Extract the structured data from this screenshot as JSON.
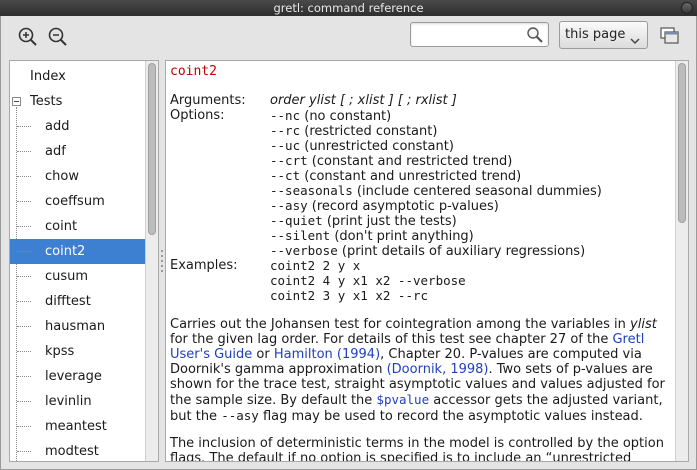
{
  "window": {
    "title": "gretl: command reference"
  },
  "toolbar": {
    "zoom_in_icon": "zoom-in-icon",
    "zoom_out_icon": "zoom-out-icon",
    "search_value": "",
    "scope_selected": "this page"
  },
  "tree": {
    "index_label": "Index",
    "tests_label": "Tests",
    "items": [
      "add",
      "adf",
      "chow",
      "coeffsum",
      "coint",
      "coint2",
      "cusum",
      "difftest",
      "hausman",
      "kpss",
      "leverage",
      "levinlin",
      "meantest",
      "modtest"
    ],
    "selected": "coint2"
  },
  "doc": {
    "command": "coint2",
    "arguments_label": "Arguments:",
    "arguments_value": "order ylist [ ; xlist ] [ ; rxlist ]",
    "options_label": "Options:",
    "options": [
      {
        "flag": "--nc",
        "desc": " (no constant)"
      },
      {
        "flag": "--rc",
        "desc": " (restricted constant)"
      },
      {
        "flag": "--uc",
        "desc": " (unrestricted constant)"
      },
      {
        "flag": "--crt",
        "desc": " (constant and restricted trend)"
      },
      {
        "flag": "--ct",
        "desc": " (constant and unrestricted trend)"
      },
      {
        "flag": "--seasonals",
        "desc": " (include centered seasonal dummies)"
      },
      {
        "flag": "--asy",
        "desc": " (record asymptotic p-values)"
      },
      {
        "flag": "--quiet",
        "desc": " (print just the tests)"
      },
      {
        "flag": "--silent",
        "desc": " (don't print anything)"
      },
      {
        "flag": "--verbose",
        "desc": " (print details of auxiliary regressions)"
      }
    ],
    "examples_label": "Examples:",
    "examples": [
      "coint2 2 y x",
      "coint2 4 y x1 x2 --verbose",
      "coint2 3 y x1 x2 --rc"
    ],
    "p1": {
      "a": "Carries out the Johansen test for cointegration among the variables in ",
      "b": "ylist",
      "c": " for the given lag order. For details of this test see chapter 27 of the ",
      "link1": "Gretl User's Guide",
      "d": " or ",
      "link2": "Hamilton (1994)",
      "e": ", Chapter 20. P-values are computed via Doornik's gamma approximation ",
      "link3": "(Doornik, 1998)",
      "f": ". Two sets of p-values are shown for the trace test, straight asymptotic values and values adjusted for the sample size. By default the ",
      "accessor": "$pvalue",
      "g": " accessor gets the adjusted variant, but the ",
      "flag": "--asy",
      "h": " flag may be used to record the asymptotic values instead."
    },
    "p2": "The inclusion of deterministic terms in the model is controlled by the option flags. The default if no option is specified is to include an “unrestricted"
  }
}
